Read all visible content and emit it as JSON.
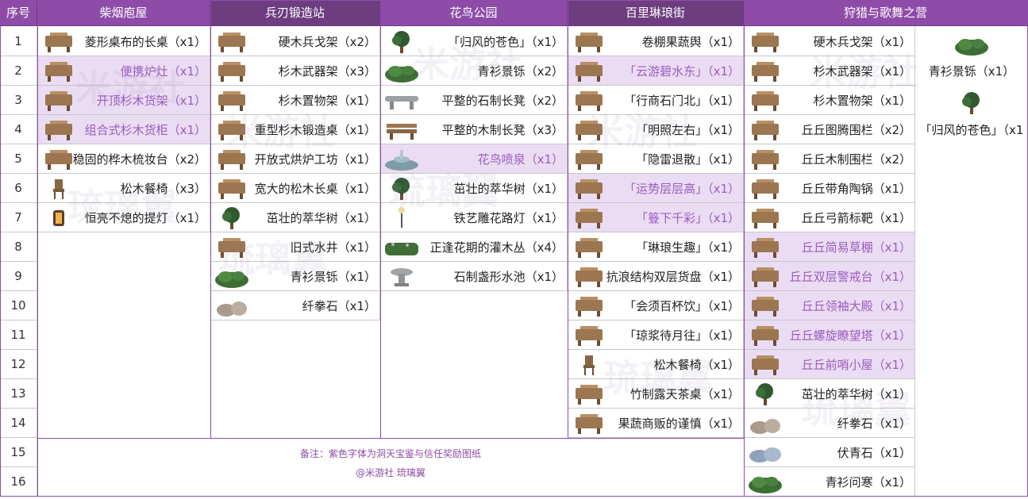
{
  "colors": {
    "header_bg": "#8e4ca8",
    "header_dark": "#6d3d80",
    "highlight_bg": "#eadcf2",
    "highlight_text": "#9b5cc0"
  },
  "header": {
    "num": "序号",
    "cols": [
      "柴烟庖屋",
      "兵刃锻造站",
      "花鸟公园",
      "百里琳琅街",
      "狩猎与歌舞之营"
    ]
  },
  "rows": [
    "1",
    "2",
    "3",
    "4",
    "5",
    "6",
    "7",
    "8",
    "9",
    "10",
    "11",
    "12",
    "13",
    "14",
    "15",
    "16"
  ],
  "columns": [
    {
      "items": [
        {
          "name": "菱形桌布的长桌（x1）",
          "purple": false,
          "icon": "table-icon"
        },
        {
          "name": "便携炉灶（x1）",
          "purple": true,
          "icon": "stove-icon"
        },
        {
          "name": "开顶杉木货架（x1）",
          "purple": true,
          "icon": "shelf-icon"
        },
        {
          "name": "组合式杉木货柜（x1）",
          "purple": true,
          "icon": "cabinet-icon"
        },
        {
          "name": "稳固的桦木梳妆台（x2）",
          "purple": false,
          "icon": "dresser-icon"
        },
        {
          "name": "松木餐椅（x3）",
          "purple": false,
          "icon": "chair-icon"
        },
        {
          "name": "恒亮不熄的提灯（x1）",
          "purple": false,
          "icon": "lantern-icon"
        }
      ]
    },
    {
      "items": [
        {
          "name": "硬木兵戈架（x2）",
          "purple": false,
          "icon": "weapon-rack-icon"
        },
        {
          "name": "杉木武器架（x3）",
          "purple": false,
          "icon": "weapon-stand-icon"
        },
        {
          "name": "杉木置物架（x1）",
          "purple": false,
          "icon": "frame-rack-icon"
        },
        {
          "name": "重型杉木锻造桌（x1）",
          "purple": false,
          "icon": "forge-table-icon"
        },
        {
          "name": "开放式烘炉工坊（x1）",
          "purple": false,
          "icon": "furnace-icon"
        },
        {
          "name": "宽大的松木长桌（x1）",
          "purple": false,
          "icon": "long-table-icon"
        },
        {
          "name": "茁壮的萃华树（x1）",
          "purple": false,
          "icon": "tree-icon"
        },
        {
          "name": "旧式水井（x1）",
          "purple": false,
          "icon": "well-icon"
        },
        {
          "name": "青衫景铄（x1）",
          "purple": false,
          "icon": "bush-icon"
        },
        {
          "name": "纤拳石（x1）",
          "purple": false,
          "icon": "rock-icon"
        }
      ]
    },
    {
      "items": [
        {
          "name": "「归风的苍色」（x1）",
          "purple": false,
          "icon": "tree-icon"
        },
        {
          "name": "青衫景铄（x2）",
          "purple": false,
          "icon": "bush-icon"
        },
        {
          "name": "平整的石制长凳（x2）",
          "purple": false,
          "icon": "stone-bench-icon"
        },
        {
          "name": "平整的木制长凳（x3）",
          "purple": false,
          "icon": "wood-bench-icon"
        },
        {
          "name": "花鸟喷泉（x1）",
          "purple": true,
          "icon": "fountain-icon"
        },
        {
          "name": "茁壮的萃华树（x1）",
          "purple": false,
          "icon": "tree-icon"
        },
        {
          "name": "铁艺雕花路灯（x1）",
          "purple": false,
          "icon": "street-lamp-icon"
        },
        {
          "name": "正逢花期的灌木丛（x4）",
          "purple": false,
          "icon": "hedge-icon"
        },
        {
          "name": "石制盏形水池（x1）",
          "purple": false,
          "icon": "basin-icon"
        }
      ]
    },
    {
      "items": [
        {
          "name": "卷棚果蔬舆（x1）",
          "purple": false,
          "icon": "cart-icon"
        },
        {
          "name": "「云游碧水东」（x1）",
          "purple": true,
          "icon": "stall-icon"
        },
        {
          "name": "「行商石门北」（x1）",
          "purple": false,
          "icon": "umbrella-stall-icon"
        },
        {
          "name": "「明照左右」（x1）",
          "purple": false,
          "icon": "lamp-post-icon"
        },
        {
          "name": "「隐雷退散」（x1）",
          "purple": false,
          "icon": "sacks-icon"
        },
        {
          "name": "「运势层层高」（x1）",
          "purple": true,
          "icon": "stand-icon"
        },
        {
          "name": "「簦下千彩」（x1）",
          "purple": true,
          "icon": "flower-stall-icon"
        },
        {
          "name": "「琳琅生趣」（x1）",
          "purple": false,
          "icon": "goods-cart-icon"
        },
        {
          "name": "抗浪结构双层货盘（x1）",
          "purple": false,
          "icon": "pallet-icon"
        },
        {
          "name": "「会须百杯饮」（x1）",
          "purple": false,
          "icon": "drink-stall-icon"
        },
        {
          "name": "「琼浆待月往」（x1）",
          "purple": false,
          "icon": "wine-stall-icon"
        },
        {
          "name": "松木餐椅（x1）",
          "purple": false,
          "icon": "chair-icon"
        },
        {
          "name": "竹制露天茶桌（x1）",
          "purple": false,
          "icon": "tea-table-icon"
        },
        {
          "name": "果蔬商贩的谨慎（x1）",
          "purple": false,
          "icon": "crates-icon"
        }
      ]
    },
    {
      "items": [
        {
          "name": "硬木兵戈架（x1）",
          "purple": false,
          "icon": "weapon-rack-icon"
        },
        {
          "name": "杉木武器架（x1）",
          "purple": false,
          "icon": "weapon-stand-icon"
        },
        {
          "name": "杉木置物架（x1）",
          "purple": false,
          "icon": "frame-rack-icon"
        },
        {
          "name": "丘丘图腾围栏（x2）",
          "purple": false,
          "icon": "totem-fence-icon"
        },
        {
          "name": "丘丘木制围栏（x2）",
          "purple": false,
          "icon": "wood-fence-icon"
        },
        {
          "name": "丘丘带角陶锅（x1）",
          "purple": false,
          "icon": "pot-icon"
        },
        {
          "name": "丘丘弓箭标靶（x1）",
          "purple": false,
          "icon": "target-icon"
        },
        {
          "name": "丘丘简易草棚（x1）",
          "purple": true,
          "icon": "hut-icon"
        },
        {
          "name": "丘丘双层警戒台（x1）",
          "purple": true,
          "icon": "watch-post-icon"
        },
        {
          "name": "丘丘领袖大殿（x1）",
          "purple": true,
          "icon": "hall-icon"
        },
        {
          "name": "丘丘螺旋瞭望塔（x1）",
          "purple": true,
          "icon": "tower-icon"
        },
        {
          "name": "丘丘前哨小屋（x1）",
          "purple": true,
          "icon": "outpost-icon"
        },
        {
          "name": "茁壮的萃华树（x1）",
          "purple": false,
          "icon": "tree-icon"
        },
        {
          "name": "纤拳石（x1）",
          "purple": false,
          "icon": "rock-icon"
        },
        {
          "name": "伏青石（x1）",
          "purple": false,
          "icon": "blue-rock-icon"
        },
        {
          "name": "青衫问寒（x1）",
          "purple": false,
          "icon": "bush-icon"
        }
      ]
    }
  ],
  "extra": [
    {
      "name": "青衫景铄（x1）",
      "icon": "bush-icon"
    },
    {
      "name": "「归风的苍色」（x1",
      "icon": "tree-icon"
    }
  ],
  "note": {
    "line1": "备注：紫色字体为洞天宝鉴与信任奖励图纸",
    "line2": "@米游社  琉璃翼"
  },
  "watermarks": [
    "米游社",
    "琉璃翼"
  ]
}
